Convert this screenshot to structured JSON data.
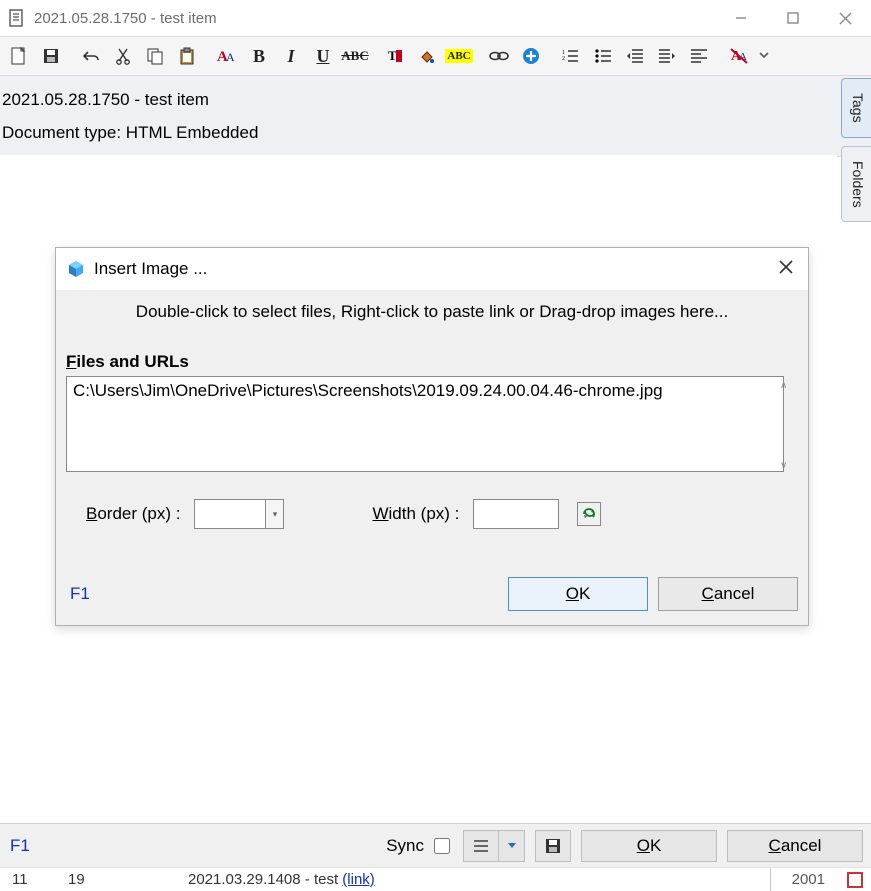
{
  "window": {
    "title": "2021.05.28.1750 - test item"
  },
  "info": {
    "line1": "2021.05.28.1750 - test item",
    "line2_label": "Document type:",
    "line2_value": "HTML Embedded"
  },
  "sidetabs": {
    "tags": "Tags",
    "folders": "Folders"
  },
  "dialog": {
    "title": "Insert Image ...",
    "hint": "Double-click to select files, Right-click to paste link or Drag-drop images here...",
    "files_label_u": "F",
    "files_label_rest": "iles and URLs",
    "path_value": "C:\\Users\\Jim\\OneDrive\\Pictures\\Screenshots\\2019.09.24.00.04.46-chrome.jpg",
    "border_label_u": "B",
    "border_label_rest": "order (px) :",
    "width_label_u": "W",
    "width_label_rest": "idth (px) :",
    "f1": "F1",
    "ok_u": "O",
    "ok_rest": "K",
    "cancel_u": "C",
    "cancel_rest": "ancel"
  },
  "footer": {
    "f1": "F1",
    "sync": "Sync",
    "ok_u": "O",
    "ok_rest": "K",
    "cancel_u": "C",
    "cancel_rest": "ancel"
  },
  "peek": {
    "col1": "11",
    "col2": "19",
    "col3_text": "2021.03.29.1408 - test ",
    "col3_link": "(link)",
    "year": "2001"
  },
  "toolbar": {
    "bold": "B",
    "italic": "I",
    "underline": "U",
    "strike": "ABC",
    "highlight": "ABC"
  }
}
